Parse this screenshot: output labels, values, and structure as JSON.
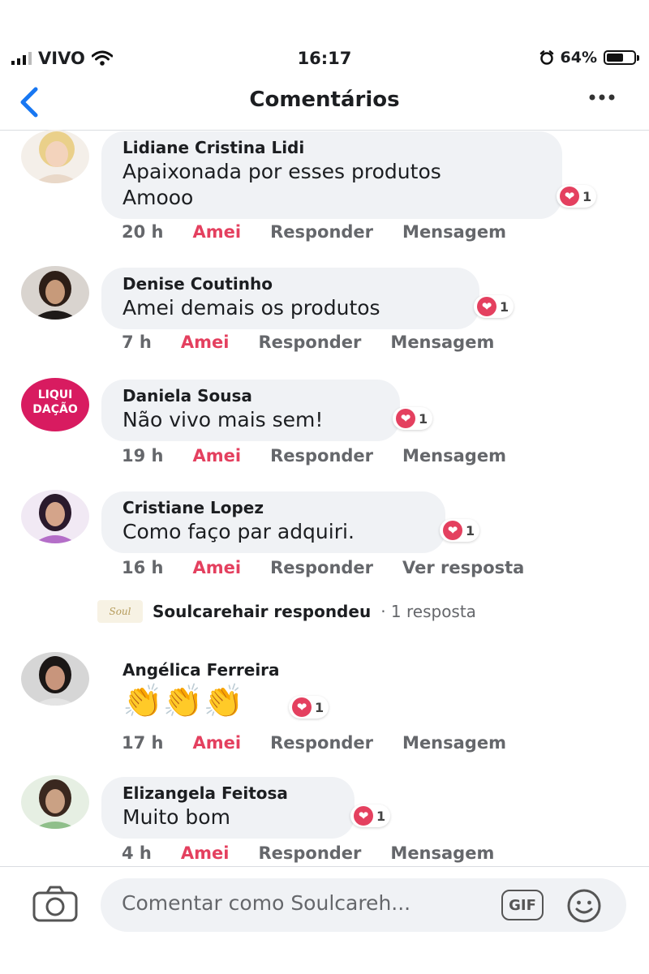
{
  "status_bar": {
    "carrier": "VIVO",
    "time": "16:17",
    "battery_percent": "64%",
    "battery_level": 0.64
  },
  "nav": {
    "back_icon": "chevron-left-icon",
    "title": "Comentários",
    "more_icon": "more-horizontal-icon"
  },
  "colors": {
    "like_active": "#e4405f",
    "bubble_bg": "#f0f2f5",
    "accent_blue": "#1877f2",
    "meta_text": "#65676b"
  },
  "comments": [
    {
      "author": "Lidiane Cristina Lidi",
      "text_lines": [
        "Apaixonada por esses produtos",
        "Amooo"
      ],
      "reaction_count": "1",
      "time": "20 h",
      "like_label": "Amei",
      "reply_label": "Responder",
      "extra_label": "Mensagem"
    },
    {
      "author": "Denise Coutinho",
      "text_lines": [
        "Amei demais os produtos"
      ],
      "reaction_count": "1",
      "time": "7 h",
      "like_label": "Amei",
      "reply_label": "Responder",
      "extra_label": "Mensagem"
    },
    {
      "author": "Daniela Sousa",
      "avatar_text": "LIQUI DAÇÃO",
      "text_lines": [
        "Não vivo mais sem!"
      ],
      "reaction_count": "1",
      "time": "19 h",
      "like_label": "Amei",
      "reply_label": "Responder",
      "extra_label": "Mensagem"
    },
    {
      "author": "Cristiane Lopez",
      "text_lines": [
        "Como faço par adquiri."
      ],
      "reaction_count": "1",
      "time": "16 h",
      "like_label": "Amei",
      "reply_label": "Responder",
      "extra_label": "Ver resposta",
      "reply_thread": {
        "text": "Soulcarehair respondeu",
        "count": "· 1 resposta",
        "logo_text": "Soul"
      }
    },
    {
      "author": "Angélica Ferreira",
      "text_lines": [
        "👏👏👏"
      ],
      "reaction_count": "1",
      "time": "17 h",
      "like_label": "Amei",
      "reply_label": "Responder",
      "extra_label": "Mensagem"
    },
    {
      "author": "Elizangela Feitosa",
      "text_lines": [
        "Muito bom"
      ],
      "reaction_count": "1",
      "time": "4 h",
      "like_label": "Amei",
      "reply_label": "Responder",
      "extra_label": "Mensagem"
    }
  ],
  "composer": {
    "camera_icon": "camera-icon",
    "placeholder": "Comentar como Soulcareh...",
    "gif_label": "GIF",
    "emoji_icon": "smiley-icon"
  }
}
